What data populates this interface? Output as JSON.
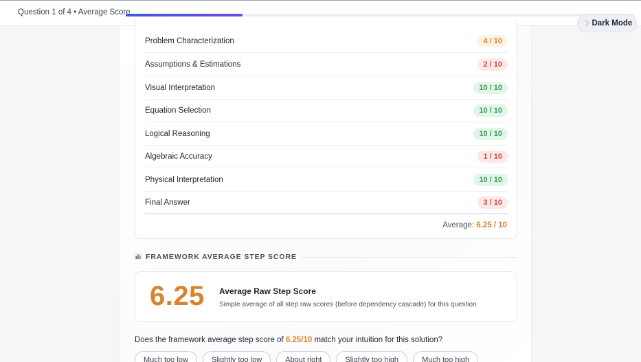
{
  "header": {
    "progress_label": "Question 1 of 4 • Average Score",
    "progress_fraction": 0.23,
    "dark_mode_label": "Dark Mode"
  },
  "scores": {
    "rows": [
      {
        "label": "Problem Characterization",
        "score": "4 / 10",
        "tone": "orange"
      },
      {
        "label": "Assumptions & Estimations",
        "score": "2 / 10",
        "tone": "red"
      },
      {
        "label": "Visual Interpretation",
        "score": "10 / 10",
        "tone": "green"
      },
      {
        "label": "Equation Selection",
        "score": "10 / 10",
        "tone": "green"
      },
      {
        "label": "Logical Reasoning",
        "score": "10 / 10",
        "tone": "green"
      },
      {
        "label": "Algebraic Accuracy",
        "score": "1 / 10",
        "tone": "red"
      },
      {
        "label": "Physical Interpretation",
        "score": "10 / 10",
        "tone": "green"
      },
      {
        "label": "Final Answer",
        "score": "3 / 10",
        "tone": "red"
      }
    ],
    "average_label": "Average:",
    "average_value": "6.25 / 10"
  },
  "framework": {
    "heading": "FRAMEWORK AVERAGE STEP SCORE",
    "big_value": "6.25",
    "title": "Average Raw Step Score",
    "description": "Simple average of all step raw scores (before dependency cascade) for this question"
  },
  "feedback": {
    "question_prefix": "Does the framework average step score of ",
    "question_value": "6.25/10",
    "question_suffix": " match your intuition for this solution?",
    "options": [
      "Much too low",
      "Slightly too low",
      "About right",
      "Slightly too high",
      "Much too high"
    ]
  },
  "colors": {
    "accent_orange": "#d9822b",
    "progress_start": "#3b5bdb",
    "progress_end": "#6d4ee6"
  }
}
